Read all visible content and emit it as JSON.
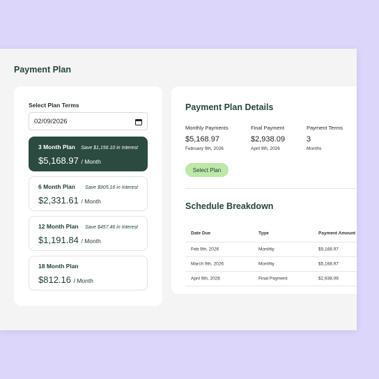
{
  "page": {
    "title": "Payment Plan"
  },
  "plan_terms": {
    "label": "Select Plan Terms",
    "date_value": "02/09/2026"
  },
  "plans": [
    {
      "name": "3 Month Plan",
      "savings": "Save $1,156.10 in Interest",
      "price": "$5,168.97",
      "per": "/ Month",
      "selected": true
    },
    {
      "name": "6 Month Plan",
      "savings": "Save $905.16 in Interest",
      "price": "$2,331.61",
      "per": "/ Month",
      "selected": false
    },
    {
      "name": "12 Month Plan",
      "savings": "Save $457.46 in Interest",
      "price": "$1,191.84",
      "per": "/ Month",
      "selected": false
    },
    {
      "name": "18 Month Plan",
      "savings": "",
      "price": "$812.16",
      "per": "/ Month",
      "selected": false
    }
  ],
  "details": {
    "title": "Payment Plan Details",
    "metrics": [
      {
        "label": "Monthly Payments",
        "value": "$5,168.97",
        "sub": "February 9th, 2026"
      },
      {
        "label": "Final Payment",
        "value": "$2,938.09",
        "sub": "April 9th, 2026"
      },
      {
        "label": "Payment Terms",
        "value": "3",
        "sub": "Months"
      }
    ],
    "select_button": "Select Plan"
  },
  "schedule": {
    "title": "Schedule Breakdown",
    "headers": [
      "Date Due",
      "Type",
      "Payment Amount"
    ],
    "rows": [
      [
        "Feb 9th, 2026",
        "Monthly",
        "$5,168.97"
      ],
      [
        "March 9th, 2026",
        "Monthly",
        "$5,168.97"
      ],
      [
        "April 9th, 2026",
        "Final Payment",
        "$2,938.09"
      ]
    ]
  },
  "colors": {
    "background": "#dcd6fb",
    "selected_plan": "#2b4a40",
    "button": "#bde8a8"
  },
  "icons": {
    "date_input": "calendar-icon"
  }
}
